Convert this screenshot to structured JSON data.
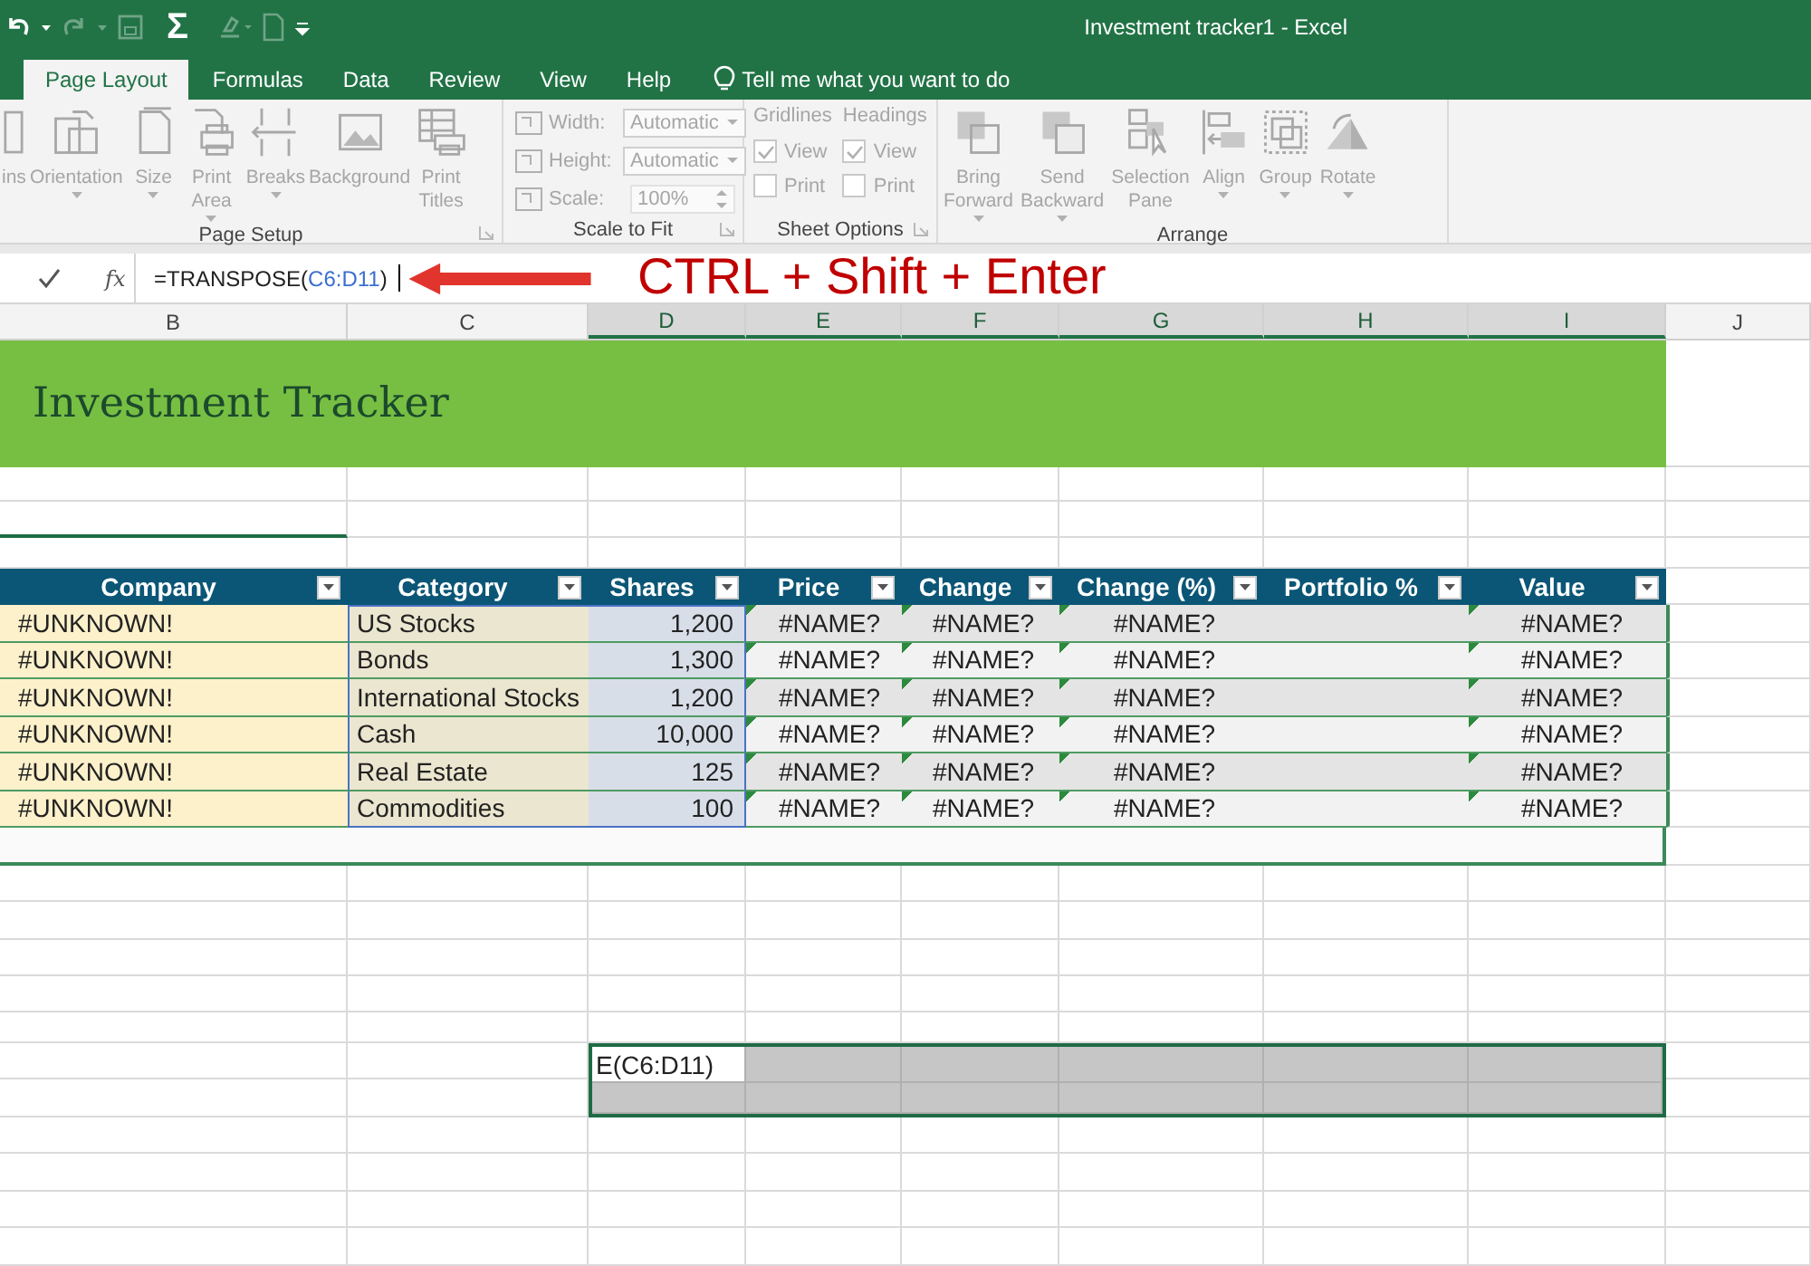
{
  "window": {
    "title": "Investment tracker1  -  Excel"
  },
  "quick_access": {
    "sum": "Σ"
  },
  "ribbon_tabs": [
    {
      "label": "Page Layout",
      "selected": true
    },
    {
      "label": "Formulas",
      "selected": false
    },
    {
      "label": "Data",
      "selected": false
    },
    {
      "label": "Review",
      "selected": false
    },
    {
      "label": "View",
      "selected": false
    },
    {
      "label": "Help",
      "selected": false
    }
  ],
  "tell_me": "Tell me what you want to do",
  "ribbon_groups": [
    {
      "label": "Page Setup",
      "kind": "buttons",
      "launcher": true,
      "disabled": true,
      "buttons": [
        {
          "lines": [
            "ins"
          ],
          "caret": false
        },
        {
          "lines": [
            "Orientation"
          ],
          "caret": true
        },
        {
          "lines": [
            "Size"
          ],
          "caret": true
        },
        {
          "lines": [
            "Print",
            "Area"
          ],
          "caret": true
        },
        {
          "lines": [
            "Breaks"
          ],
          "caret": true
        },
        {
          "lines": [
            "Background"
          ],
          "caret": false
        },
        {
          "lines": [
            "Print",
            "Titles"
          ],
          "caret": false
        }
      ]
    },
    {
      "label": "Scale to Fit",
      "kind": "fields",
      "launcher": true,
      "disabled": true,
      "fields": [
        {
          "label": "Width:",
          "value": "Automatic",
          "kind": "dropdown"
        },
        {
          "label": "Height:",
          "value": "Automatic",
          "kind": "dropdown"
        },
        {
          "label": "Scale:",
          "value": "100%",
          "kind": "spinner"
        }
      ]
    },
    {
      "label": "Sheet Options",
      "kind": "options",
      "launcher": true,
      "disabled": true,
      "sections": [
        {
          "title": "Gridlines",
          "options": [
            {
              "label": "View",
              "checked": true
            },
            {
              "label": "Print",
              "checked": false
            }
          ]
        },
        {
          "title": "Headings",
          "options": [
            {
              "label": "View",
              "checked": true
            },
            {
              "label": "Print",
              "checked": false
            }
          ]
        }
      ]
    },
    {
      "label": "Arrange",
      "kind": "buttons",
      "launcher": false,
      "disabled": true,
      "buttons": [
        {
          "lines": [
            "Bring",
            "Forward"
          ],
          "caret": true
        },
        {
          "lines": [
            "Send",
            "Backward"
          ],
          "caret": true
        },
        {
          "lines": [
            "Selection",
            "Pane"
          ],
          "caret": false
        },
        {
          "lines": [
            "Align"
          ],
          "caret": true
        },
        {
          "lines": [
            "Group"
          ],
          "caret": true
        },
        {
          "lines": [
            "Rotate"
          ],
          "caret": true
        }
      ]
    }
  ],
  "formula_bar": {
    "insert_function": "fx",
    "formula_start": "=TRANSPOSE(",
    "formula_reference": "C6:D11",
    "formula_end": ")"
  },
  "annotation": "CTRL + Shift + Enter",
  "sheet_columns": [
    {
      "letter": "B",
      "selected": false
    },
    {
      "letter": "C",
      "selected": false
    },
    {
      "letter": "D",
      "selected": true
    },
    {
      "letter": "E",
      "selected": true
    },
    {
      "letter": "F",
      "selected": true
    },
    {
      "letter": "G",
      "selected": true
    },
    {
      "letter": "H",
      "selected": true
    },
    {
      "letter": "I",
      "selected": true
    },
    {
      "letter": "J",
      "selected": false
    }
  ],
  "banner_title": "Investment Tracker",
  "table": {
    "columns": [
      {
        "label": "Company",
        "flagged": false,
        "selected": false
      },
      {
        "label": "Category",
        "flagged": false,
        "selected": true
      },
      {
        "label": "Shares",
        "flagged": false,
        "selected": true
      },
      {
        "label": "Price",
        "flagged": true,
        "selected": false
      },
      {
        "label": "Change",
        "flagged": true,
        "selected": false
      },
      {
        "label": "Change (%)",
        "flagged": true,
        "selected": false
      },
      {
        "label": "Portfolio %",
        "flagged": false,
        "selected": false
      },
      {
        "label": "Value",
        "flagged": true,
        "selected": false
      }
    ],
    "rows": [
      {
        "company": "#UNKNOWN!",
        "category": "US Stocks",
        "shares": "1,200",
        "price": "#NAME?",
        "change": "#NAME?",
        "change_pct": "#NAME?",
        "value": "#NAME?"
      },
      {
        "company": "#UNKNOWN!",
        "category": "Bonds",
        "shares": "1,300",
        "price": "#NAME?",
        "change": "#NAME?",
        "change_pct": "#NAME?",
        "value": "#NAME?"
      },
      {
        "company": "#UNKNOWN!",
        "category": "International Stocks",
        "shares": "1,200",
        "price": "#NAME?",
        "change": "#NAME?",
        "change_pct": "#NAME?",
        "value": "#NAME?"
      },
      {
        "company": "#UNKNOWN!",
        "category": "Cash",
        "shares": "10,000",
        "price": "#NAME?",
        "change": "#NAME?",
        "change_pct": "#NAME?",
        "value": "#NAME?"
      },
      {
        "company": "#UNKNOWN!",
        "category": "Real Estate",
        "shares": "125",
        "price": "#NAME?",
        "change": "#NAME?",
        "change_pct": "#NAME?",
        "value": "#NAME?"
      },
      {
        "company": "#UNKNOWN!",
        "category": "Commodities",
        "shares": "100",
        "price": "#NAME?",
        "change": "#NAME?",
        "change_pct": "#NAME?",
        "value": "#NAME?"
      }
    ]
  },
  "output_range": {
    "text": "E(C6:D11)"
  }
}
